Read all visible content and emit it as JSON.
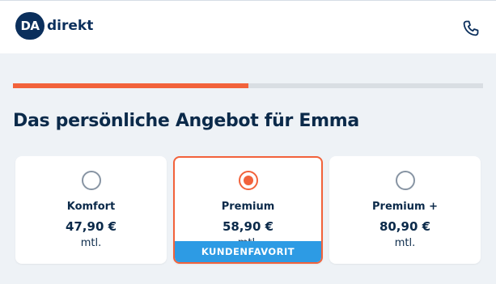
{
  "header": {
    "logo_badge": "DA",
    "logo_text": "direkt",
    "phone_icon": "phone-icon"
  },
  "progress": {
    "fraction": 0.5,
    "fill_color": "#f2623b",
    "track_color": "#d9dee3"
  },
  "title": "Das persönliche Angebot für Emma",
  "plans": [
    {
      "name": "Komfort",
      "price": "47,90 €",
      "period": "mtl.",
      "selected": false
    },
    {
      "name": "Premium",
      "price": "58,90 €",
      "period": "mtl.",
      "selected": true,
      "badge": "KUNDENFAVORIT"
    },
    {
      "name": "Premium +",
      "price": "80,90 €",
      "period": "mtl.",
      "selected": false
    }
  ],
  "colors": {
    "accent": "#f2623b",
    "brand": "#0b2f5c",
    "badge": "#2d9be4",
    "background": "#eef2f6"
  }
}
